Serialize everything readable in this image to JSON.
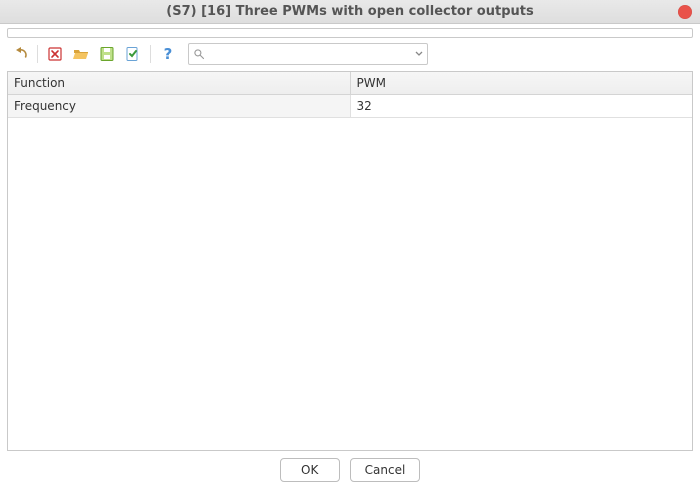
{
  "window": {
    "title": "(S7) [16] Three PWMs with open collector outputs"
  },
  "toolbar": {
    "icons": {
      "undo": "undo-icon",
      "delete": "delete-icon",
      "open": "open-folder-icon",
      "save": "save-icon",
      "validate": "validate-icon",
      "help": "help-icon"
    },
    "search": {
      "placeholder": "",
      "value": ""
    }
  },
  "table": {
    "headers": [
      "Function",
      "PWM"
    ],
    "rows": [
      {
        "label": "Frequency",
        "value": "32"
      }
    ]
  },
  "footer": {
    "ok": "OK",
    "cancel": "Cancel"
  }
}
